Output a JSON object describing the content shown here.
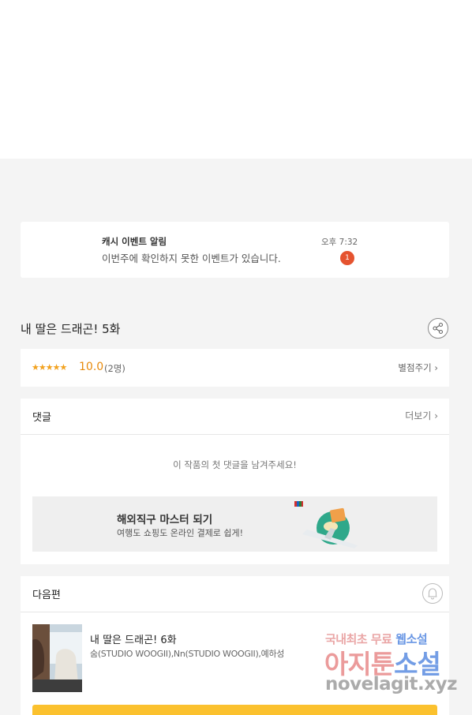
{
  "notification": {
    "title": "캐시 이벤트 알림",
    "message": "이번주에 확인하지 못한 이벤트가 있습니다.",
    "time": "오후 7:32",
    "badge": "1"
  },
  "episode": {
    "title": "내 딸은 드래곤! 5화",
    "share_icon": "share-icon"
  },
  "rating": {
    "stars": "★★★★★",
    "score": "10.0",
    "count": "(2명)",
    "rate_link": "별점주기 ›"
  },
  "comments": {
    "label": "댓글",
    "more": "더보기 ›",
    "empty": "이 작품의 첫 댓글을 남겨주세요!"
  },
  "ad": {
    "headline": "해외직구 마스터 되기",
    "subline": "여행도 쇼핑도 온라인 결제로 쉽게!"
  },
  "next_episode": {
    "label": "다음편",
    "title": "내 딸은 드래곤! 6화",
    "authors": "숨(STUDIO WOOGII),Nn(STUDIO WOOGII),예하성",
    "bell_icon": "bell-icon"
  },
  "watermark": {
    "line1_pink": "국내최초 무료",
    "line1_blue": "웹소설",
    "line2_pink": "아지툰",
    "line2_blue": "소설",
    "line3": "novelagit.xyz"
  },
  "colors": {
    "accent_orange": "#e88a0b",
    "badge_red": "#e5532f",
    "button_yellow": "#fbc12e"
  }
}
